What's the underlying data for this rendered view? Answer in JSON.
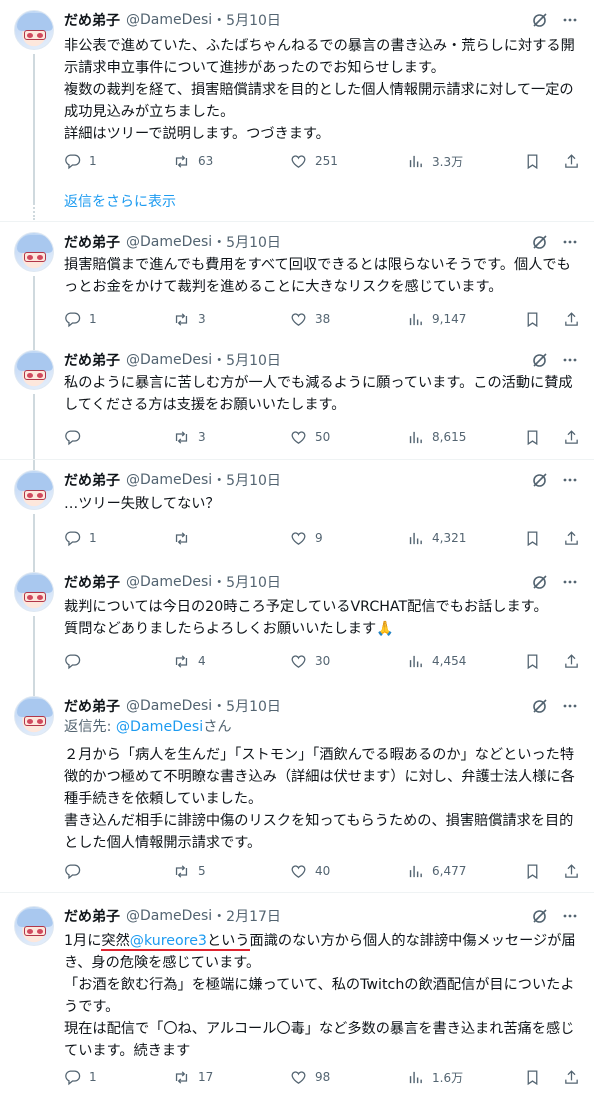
{
  "colors": {
    "accent": "#1d9bf0",
    "secondary_text": "#536471",
    "annotation_red": "#e0232f"
  },
  "icons": {
    "grok": "slash-circle-icon",
    "more": "more-dots-icon",
    "reply": "reply-icon",
    "retweet": "retweet-icon",
    "like": "heart-icon",
    "views": "views-chart-icon",
    "bookmark": "bookmark-icon",
    "share": "share-icon"
  },
  "show_more_replies": "返信をさらに表示",
  "tweets": [
    {
      "name": "だめ弟子",
      "handle": "@DameDesi",
      "date": "・5月10日",
      "text": "非公表で進めていた、ふたばちゃんねるでの暴言の書き込み・荒らしに対する開示請求申立事件について進捗があったのでお知らせします。\n複数の裁判を経て、損害賠償請求を目的とした個人情報開示請求に対して一定の成功見込みが立ちました。\n詳細はツリーで説明します。つづきます。",
      "replies": "1",
      "retweets": "63",
      "likes": "251",
      "views": "3.3万"
    },
    {
      "name": "だめ弟子",
      "handle": "@DameDesi",
      "date": "・5月10日",
      "text": "損害賠償まで進んでも費用をすべて回収できるとは限らないそうです。個人でもっとお金をかけて裁判を進めることに大きなリスクを感じています。",
      "replies": "1",
      "retweets": "3",
      "likes": "38",
      "views": "9,147"
    },
    {
      "name": "だめ弟子",
      "handle": "@DameDesi",
      "date": "・5月10日",
      "text": "私のように暴言に苦しむ方が一人でも減るように願っています。この活動に賛成してくださる方は支援をお願いいたします。",
      "replies": "",
      "retweets": "3",
      "likes": "50",
      "views": "8,615"
    },
    {
      "name": "だめ弟子",
      "handle": "@DameDesi",
      "date": "・5月10日",
      "text": "…ツリー失敗してない？",
      "replies": "1",
      "retweets": "",
      "likes": "9",
      "views": "4,321"
    },
    {
      "name": "だめ弟子",
      "handle": "@DameDesi",
      "date": "・5月10日",
      "text": "裁判については今日の20時ころ予定しているVRCHAT配信でもお話します。\n質問などありましたらよろしくお願いいたします🙏",
      "replies": "",
      "retweets": "4",
      "likes": "30",
      "views": "4,454"
    },
    {
      "name": "だめ弟子",
      "handle": "@DameDesi",
      "date": "・5月10日",
      "reply_prefix": "返信先: ",
      "reply_mention": "@DameDesi",
      "reply_suffix": "さん",
      "text": "２月から「病人を生んだ」「ストモン」「酒飲んでる暇あるのか」などといった特徴的かつ極めて不明瞭な書き込み（詳細は伏せます）に対し、弁護士法人様に各種手続きを依頼していました。\n書き込んだ相手に誹謗中傷のリスクを知ってもらうための、損害賠償請求を目的とした個人情報開示請求です。",
      "replies": "",
      "retweets": "5",
      "likes": "40",
      "views": "6,477"
    },
    {
      "name": "だめ弟子",
      "handle": "@DameDesi",
      "date": "・2月17日",
      "text_a": "1月に",
      "text_b": "突然",
      "text_mention": "@kureore3",
      "text_c": "という",
      "text_d": "面識のない方から個人的な誹謗中傷メッセージが届き、身の危険を感じています。\n「お酒を飲む行為」を極端に嫌っていて、私のTwitchの飲酒配信が目についたようです。\n現在は配信で「〇ね、アルコール〇毒」など多数の暴言を書き込まれ苦痛を感じています。続きます",
      "replies": "1",
      "retweets": "17",
      "likes": "98",
      "views": "1.6万"
    }
  ]
}
